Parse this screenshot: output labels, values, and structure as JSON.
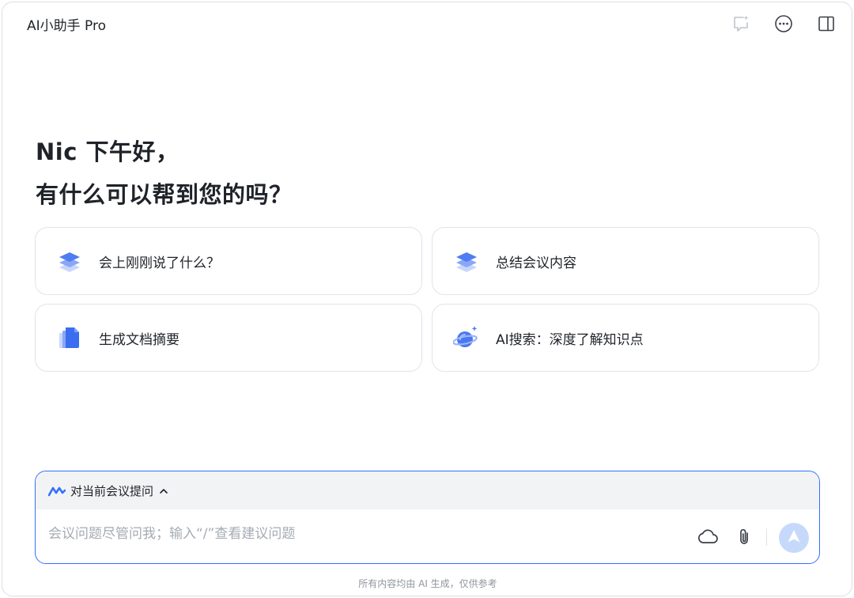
{
  "header": {
    "title": "AI小助手 Pro",
    "icons": [
      "new-chat-icon",
      "more-icon",
      "side-panel-icon"
    ]
  },
  "greeting": {
    "line1": "Nic 下午好，",
    "line2": "有什么可以帮到您的吗？"
  },
  "suggestions": [
    {
      "label": "会上刚刚说了什么？",
      "icon": "layers-icon"
    },
    {
      "label": "总结会议内容",
      "icon": "layers-icon"
    },
    {
      "label": "生成文档摘要",
      "icon": "document-icon"
    },
    {
      "label": "AI搜索：深度了解知识点",
      "icon": "planet-icon"
    }
  ],
  "composer": {
    "context_label": "对当前会议提问",
    "placeholder": "会议问题尽管问我；输入“/”查看建议问题",
    "value": ""
  },
  "footer": "所有内容均由 AI 生成，仅供参考",
  "colors": {
    "accent": "#3370ff",
    "send_disabled": "#c7d9fb",
    "text": "#1f2329",
    "muted": "#8f959e"
  }
}
